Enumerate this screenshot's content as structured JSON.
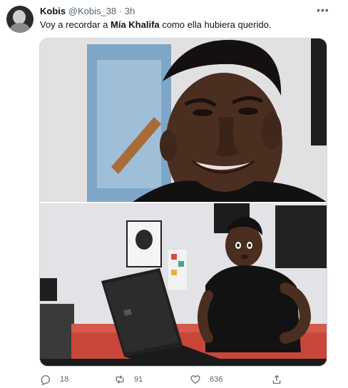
{
  "tweet": {
    "author_name": "Kobis",
    "author_handle": "@Kobis_38",
    "separator": "·",
    "time": "3h",
    "text_before": "Voy a recordar a ",
    "text_bold": "Mía Khalifa",
    "text_after": " como ella hubiera querido.",
    "more_icon": "more-horizontal-icon",
    "media_description_icons": [
      "meme-top-panel",
      "meme-bottom-panel"
    ]
  },
  "actions": {
    "reply_count": "18",
    "retweet_count": "91",
    "like_count": "636",
    "icons": [
      "reply-icon",
      "retweet-icon",
      "like-icon",
      "share-icon"
    ]
  },
  "colors": {
    "secondary_text": "#536471",
    "border": "#cfd9de"
  }
}
